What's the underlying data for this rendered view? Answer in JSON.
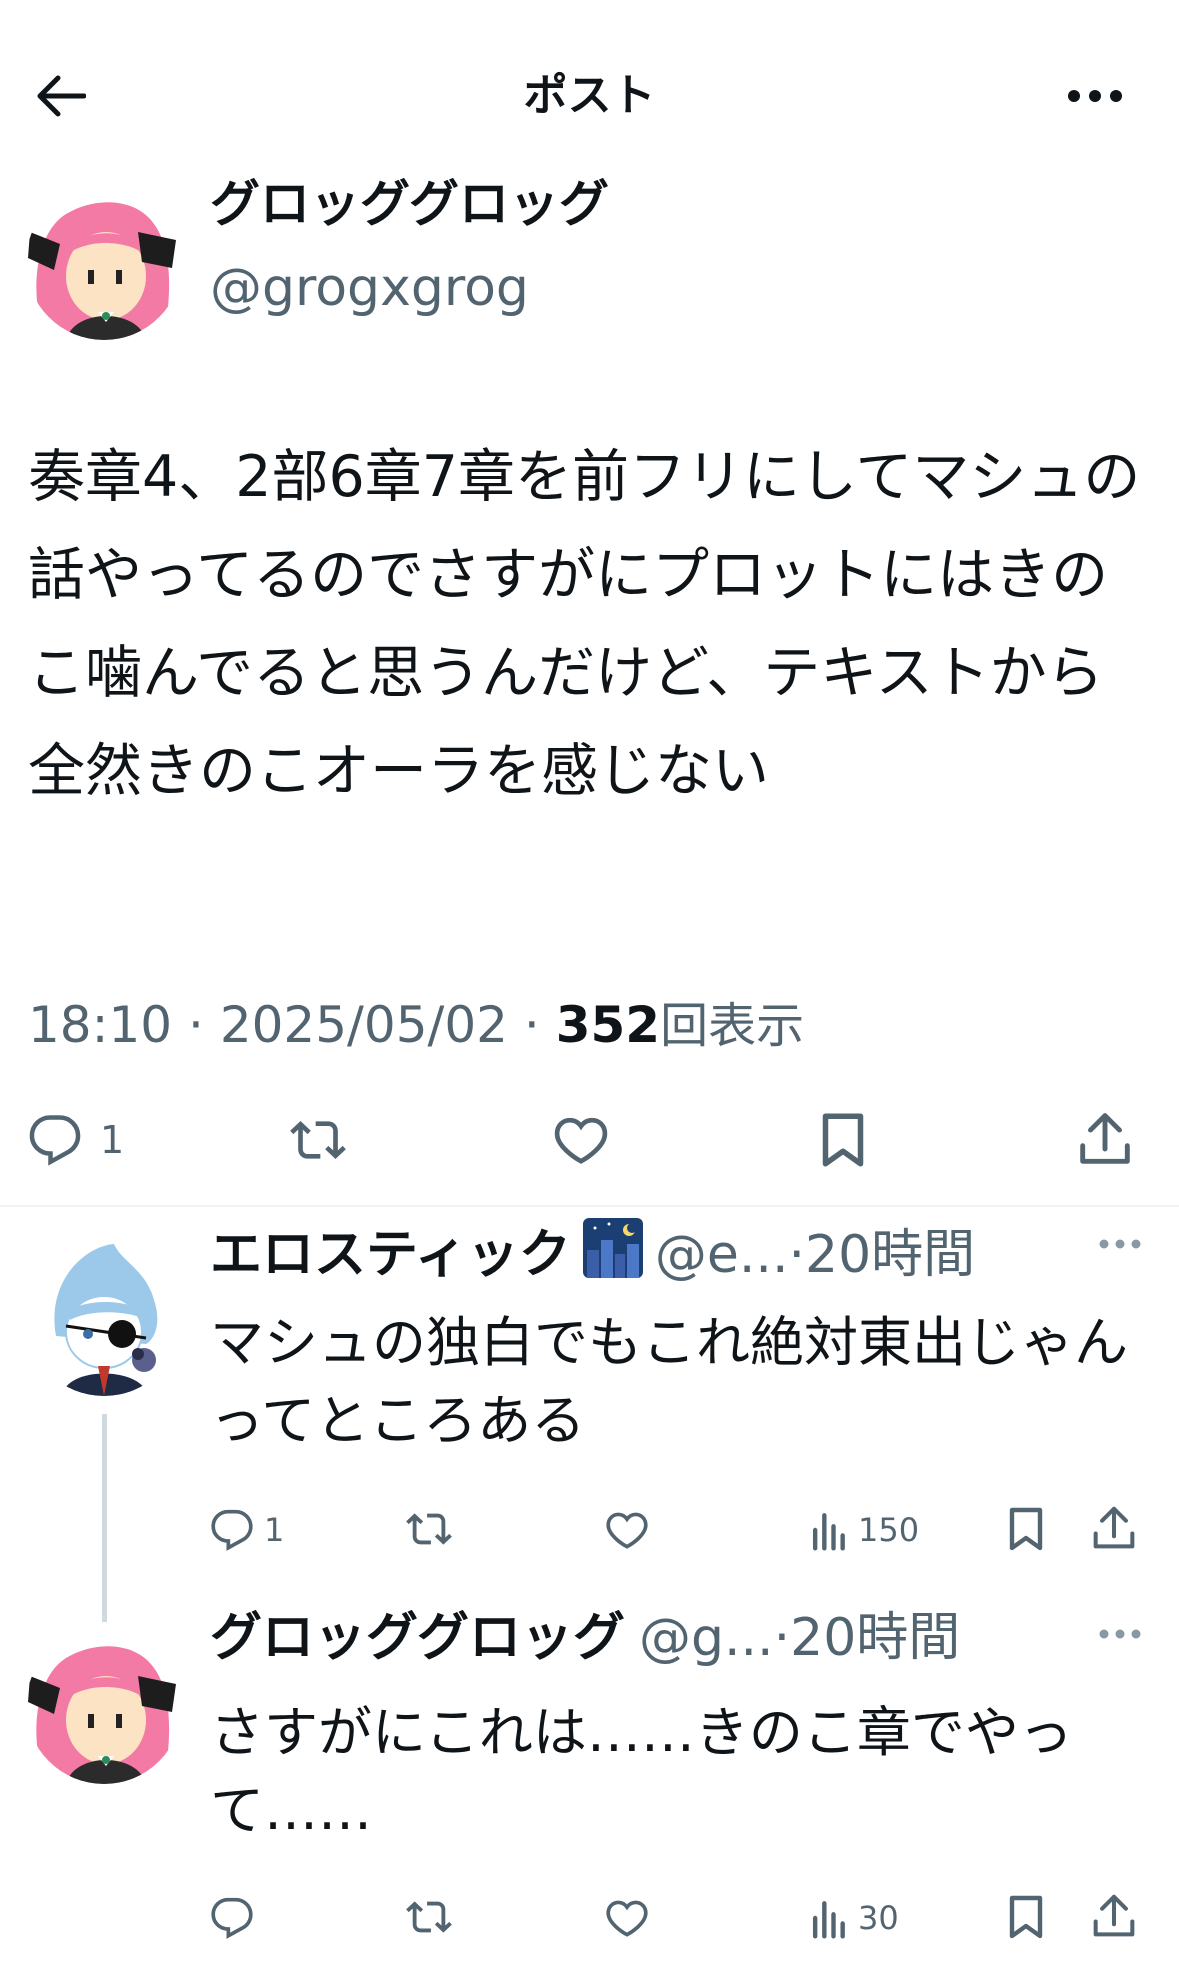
{
  "header": {
    "title": "ポスト",
    "back_icon": "back-arrow-icon",
    "more_icon": "more-icon"
  },
  "main_post": {
    "author_name": "グロッググロッグ",
    "handle": "@grogxgrog",
    "text": "奏章4、2部6章7章を前フリにしてマシュの話やってるのでさすがにプロットにはきのこ噛んでると思うんだけど、テキストから全然きのこオーラを感じない",
    "time": "18:10",
    "date": "2025/05/02",
    "separator": "·",
    "views_count": "352",
    "views_label": "回表示",
    "reply_count": "1",
    "avatar_colors": {
      "hair": "#f47aa6",
      "face": "#fbe3c4",
      "bow": "#1d1d1d",
      "uniform": "#2b2b2b"
    }
  },
  "replies": [
    {
      "author_name": "エロスティック",
      "handle_truncated": "@e...",
      "time": "·20時間",
      "text": "マシュの独白でもこれ絶対東出じゃんってところある",
      "reply_count": "1",
      "views_count": "150",
      "avatar_colors": {
        "hair": "#9cc8ea",
        "face": "#ffffff",
        "eyepatch": "#111111",
        "vest": "#1f2a44",
        "tie": "#c0392b"
      }
    },
    {
      "author_name": "グロッググロッグ",
      "handle_truncated": "@g...",
      "time": "·20時間",
      "text": "さすがにこれは……きのこ章でやって……",
      "reply_count": "",
      "views_count": "30",
      "avatar_colors": {
        "hair": "#f47aa6",
        "face": "#fbe3c4",
        "bow": "#1d1d1d",
        "uniform": "#2b2b2b"
      }
    }
  ],
  "colors": {
    "text": "#0f1419",
    "secondary": "#536471",
    "divider": "#eff3f4",
    "thread_line": "#cfd9de"
  },
  "icons": [
    "reply-icon",
    "repost-icon",
    "like-icon",
    "bookmark-icon",
    "share-icon",
    "views-icon",
    "more-icon",
    "city-night-emoji"
  ]
}
